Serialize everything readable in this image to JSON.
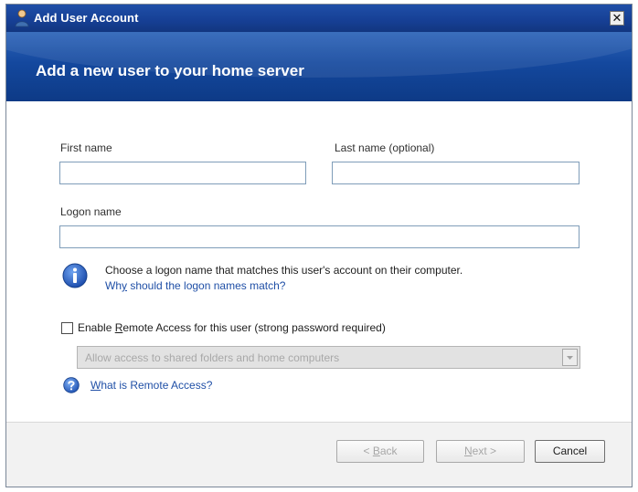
{
  "window": {
    "title": "Add User Account",
    "close_glyph": "✕"
  },
  "banner": {
    "title": "Add a new user to your home server"
  },
  "form": {
    "first_name_label": "First name",
    "first_name_value": "",
    "last_name_label": "Last name (optional)",
    "last_name_value": "",
    "logon_name_label": "Logon name",
    "logon_name_value": ""
  },
  "info": {
    "icon": "info-icon",
    "text": "Choose a logon name that matches this user's account on their computer.",
    "link_prefix": "Wh",
    "link_underlined": "y",
    "link_suffix": " should the logon names match?"
  },
  "remote_access": {
    "checked": false,
    "label_prefix": "Enable ",
    "label_underlined": "R",
    "label_suffix": "emote Access for this user (strong password required)",
    "select_value": "Allow access to shared folders and home computers",
    "select_enabled": false,
    "help_icon": "question-icon",
    "help_link_underlined": "W",
    "help_link_suffix": "hat is Remote Access?"
  },
  "buttons": {
    "back_prefix": "< ",
    "back_underlined": "B",
    "back_suffix": "ack",
    "next_underlined": "N",
    "next_suffix": "ext >",
    "cancel": "Cancel"
  },
  "colors": {
    "banner_blue": "#14489e",
    "link_blue": "#1f4fa6",
    "disabled_text": "#a7a7a7"
  }
}
